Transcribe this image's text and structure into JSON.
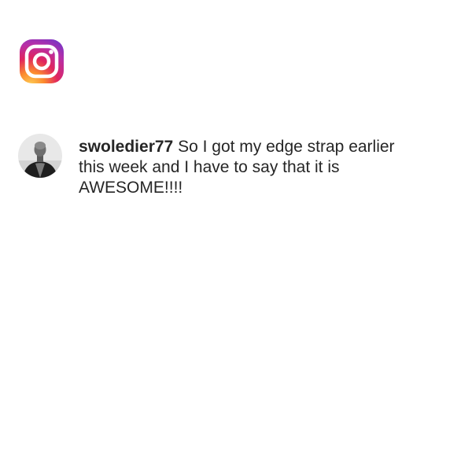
{
  "app": {
    "logo_icon": "instagram-logo-icon"
  },
  "comment": {
    "avatar_icon": "user-avatar-icon",
    "username": "swoledier77",
    "text": "So I got my edge strap earlier this week and I have to say that it is AWESOME!!!!"
  },
  "colors": {
    "text": "#262626",
    "background": "#ffffff",
    "logo_gradient": [
      "#feda75",
      "#fa7e1e",
      "#d62976",
      "#962fbf",
      "#4f5bd5"
    ]
  }
}
